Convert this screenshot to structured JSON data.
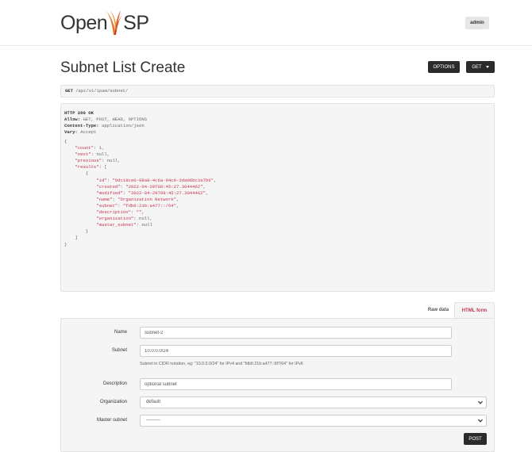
{
  "logo": {
    "part1": "Open",
    "part2": "i",
    "part3": "SP"
  },
  "user": {
    "name": "admin"
  },
  "page": {
    "title": "Subnet List Create"
  },
  "buttons": {
    "options": "OPTIONS",
    "get": "GET",
    "post": "POST"
  },
  "request": {
    "method": "GET",
    "path": "/api/v1/ipam/subnet/"
  },
  "response": {
    "status": "HTTP 200 OK",
    "headers": [
      {
        "name": "Allow:",
        "value": "GET, POST, HEAD, OPTIONS"
      },
      {
        "name": "Content-Type:",
        "value": "application/json"
      },
      {
        "name": "Vary:",
        "value": "Accept"
      }
    ],
    "count": "1",
    "next": "null",
    "previous": "null",
    "result": {
      "id": "\"9dc18ce0-98a8-4c6a-94c9-3da06bc3a7b6\"",
      "created": "\"2022-04-29T08:45:27.304446Z\"",
      "modified": "\"2022-04-29T08:45:27.304446Z\"",
      "name": "\"Organization Network\"",
      "subnet": "\"fdb6:21b:a477::/64\"",
      "description": "\"\"",
      "organization": "null",
      "master_subnet": "null"
    }
  },
  "tabs": {
    "raw": "Raw data",
    "html": "HTML form"
  },
  "form": {
    "name_label": "Name",
    "name_value": "subnet-2",
    "subnet_label": "Subnet",
    "subnet_value": "10.0.0.0/24",
    "subnet_help": "Subnet in CIDR notation, eg: \"10.0.0.0/24\" for IPv4 and \"fdb6:21b:a477::9f7/64\" for IPv6",
    "description_label": "Description",
    "description_value": "optional subnet",
    "organization_label": "Organization",
    "organization_value": "default",
    "master_subnet_label": "Master subnet",
    "master_subnet_value": "---------"
  },
  "colors": {
    "accent": "#c4334f",
    "dark_button": "#2b2b2b",
    "logo_orange": "#e8742a"
  }
}
